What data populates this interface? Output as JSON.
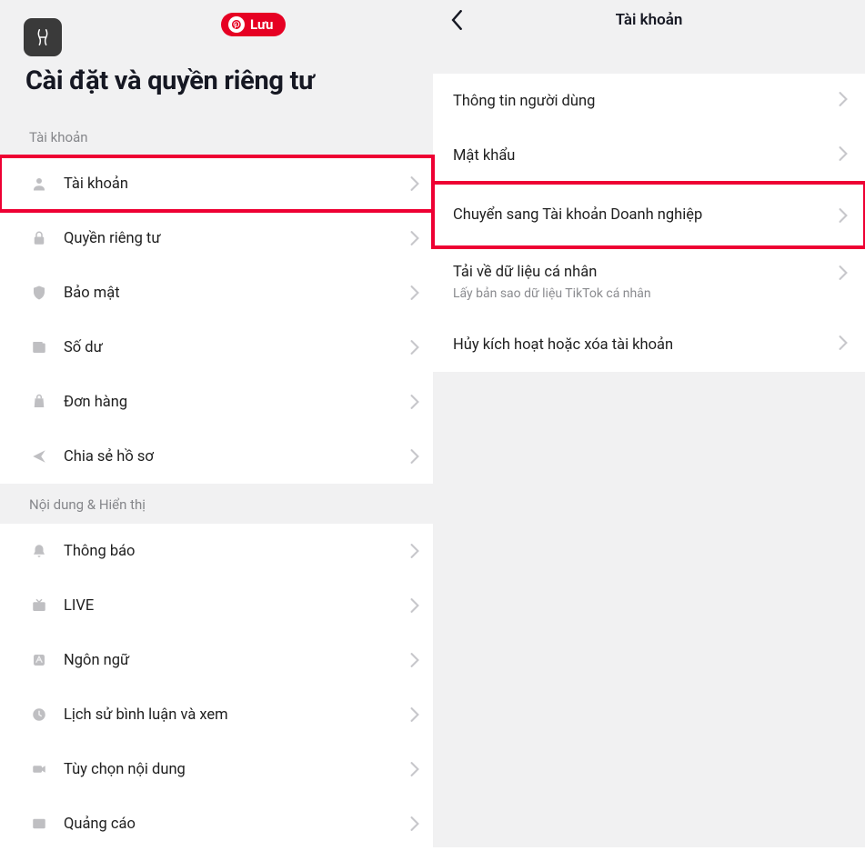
{
  "pill": {
    "label": "Lưu"
  },
  "left": {
    "title": "Cài đặt và quyền riêng tư",
    "sections": [
      {
        "label": "Tài khoản",
        "items": [
          {
            "icon": "person",
            "label": "Tài khoản",
            "highlight": true
          },
          {
            "icon": "lock",
            "label": "Quyền riêng tư"
          },
          {
            "icon": "shield",
            "label": "Bảo mật"
          },
          {
            "icon": "wallet",
            "label": "Số dư"
          },
          {
            "icon": "bag",
            "label": "Đơn hàng"
          },
          {
            "icon": "share",
            "label": "Chia sẻ hồ sơ"
          }
        ]
      },
      {
        "label": "Nội dung & Hiển thị",
        "items": [
          {
            "icon": "bell",
            "label": "Thông báo"
          },
          {
            "icon": "tv",
            "label": "LIVE"
          },
          {
            "icon": "lang",
            "label": "Ngôn ngữ"
          },
          {
            "icon": "clock",
            "label": "Lịch sử bình luận và xem"
          },
          {
            "icon": "video",
            "label": "Tùy chọn nội dung"
          },
          {
            "icon": "ad",
            "label": "Quảng cáo"
          }
        ]
      }
    ]
  },
  "right": {
    "title": "Tài khoản",
    "items": [
      {
        "label": "Thông tin người dùng"
      },
      {
        "label": "Mật khẩu"
      },
      {
        "label": "Chuyển sang Tài khoản Doanh nghiệp",
        "highlight": true
      },
      {
        "label": "Tải về dữ liệu cá nhân",
        "sub": "Lấy bản sao dữ liệu TikTok cá nhân"
      },
      {
        "label": "Hủy kích hoạt hoặc xóa tài khoản"
      }
    ]
  }
}
